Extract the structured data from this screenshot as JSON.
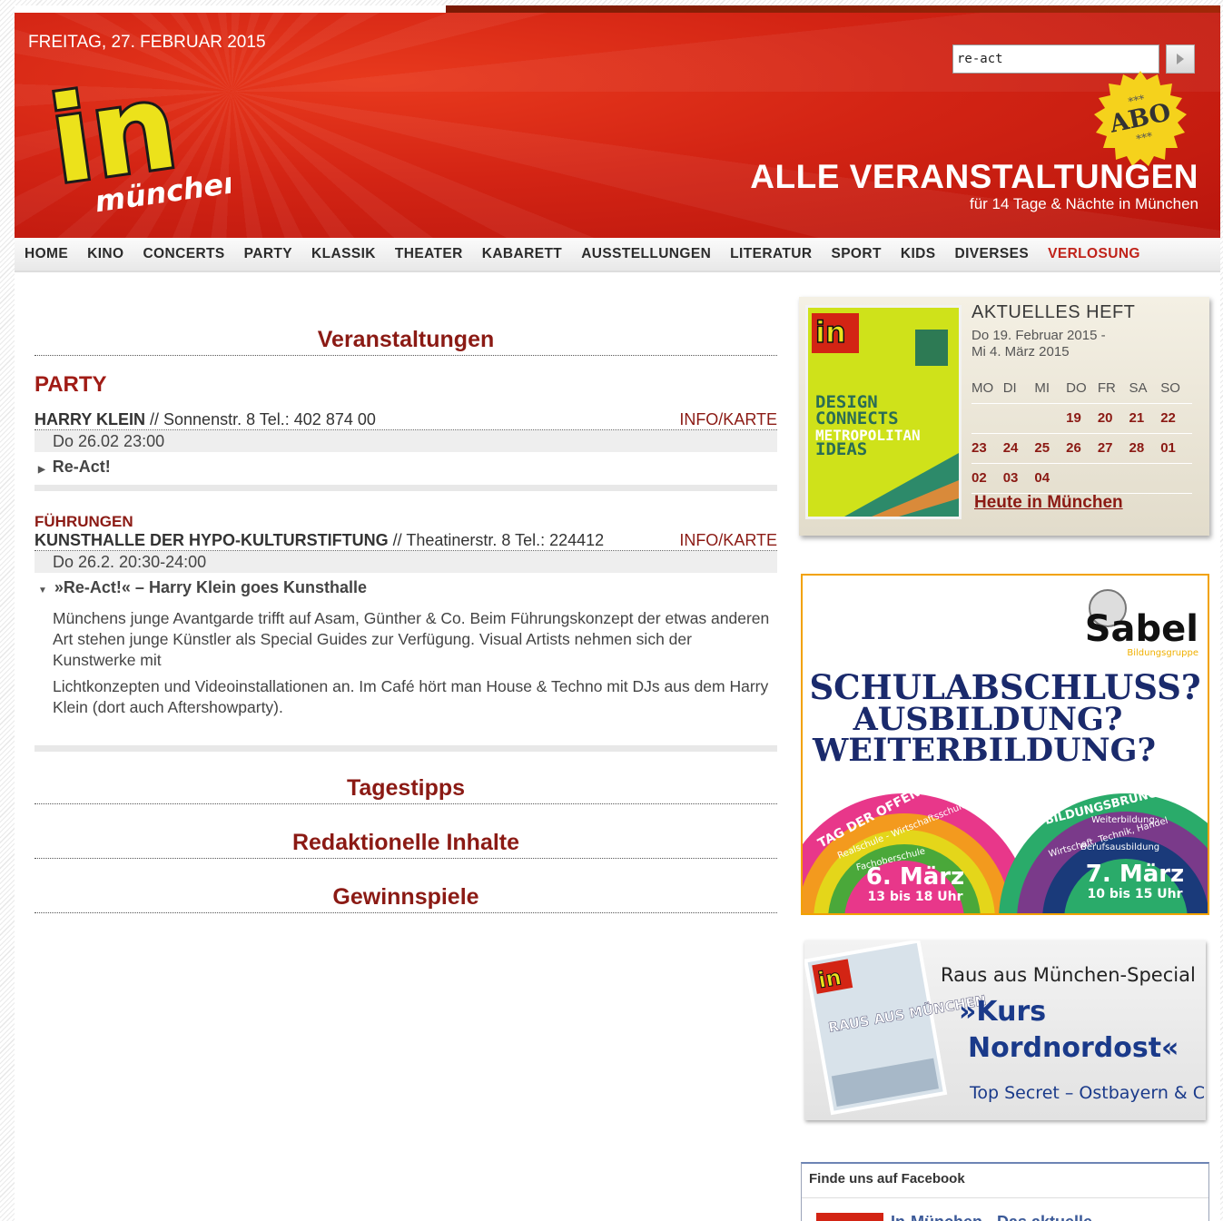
{
  "header": {
    "date": "FREITAG, 27. FEBRUAR 2015",
    "logo_main": "in",
    "logo_sub": "münchen",
    "search_value": "re-act",
    "abo_label": "ABO",
    "abo_stars": "***",
    "headline": "ALLE VERANSTALTUNGEN",
    "subline": "für 14 Tage & Nächte in München"
  },
  "nav": [
    "HOME",
    "KINO",
    "CONCERTS",
    "PARTY",
    "KLASSIK",
    "THEATER",
    "KABARETT",
    "AUSSTELLUNGEN",
    "LITERATUR",
    "SPORT",
    "KIDS",
    "DIVERSES",
    "VERLOSUNG"
  ],
  "main": {
    "section_title": "Veranstaltungen",
    "party_heading": "PARTY",
    "event1": {
      "venue": "HARRY KLEIN",
      "address": " // Sonnenstr. 8 Tel.: 402 874 00",
      "info": "INFO/KARTE",
      "date": "Do 26.02 23:00",
      "title": "Re-Act!"
    },
    "event2": {
      "category": "FÜHRUNGEN",
      "venue": "KUNSTHALLE DER HYPO-KULTURSTIFTUNG",
      "address": " // Theatinerstr. 8 Tel.: 224412",
      "info": "INFO/KARTE",
      "date": "Do 26.2. 20:30-24:00",
      "title": "»Re-Act!« – Harry Klein goes Kunsthalle",
      "desc1": "Münchens junge Avantgarde trifft auf Asam, Günther & Co. Beim Führungskonzept der etwas anderen Art stehen junge Künstler als Special Guides zur Verfügung. Visual Artists nehmen sich der Kunstwerke mit",
      "desc2": "Lichtkonzepten und Videoinstallationen an. Im Café hört man House & Techno mit DJs aus dem Harry Klein (dort auch Aftershowparty)."
    },
    "tagestipps": "Tagestipps",
    "redaktionell": "Redaktionelle Inhalte",
    "gewinnspiele": "Gewinnspiele"
  },
  "heft": {
    "title": "AKTUELLES HEFT",
    "date_line1": "Do 19. Februar 2015 -",
    "date_line2": "Mi 4. März 2015",
    "weekdays": [
      "MO",
      "DI",
      "MI",
      "DO",
      "FR",
      "SA",
      "SO"
    ],
    "weeks": [
      [
        "",
        "",
        "",
        "19",
        "20",
        "21",
        "22"
      ],
      [
        "23",
        "24",
        "25",
        "26",
        "27",
        "28",
        "01"
      ],
      [
        "02",
        "03",
        "04",
        "",
        "",
        "",
        ""
      ]
    ],
    "heute": "Heute in München",
    "cover_texts": [
      "DESIGN",
      "CONNECTS",
      "METROPOLITAN",
      "IDEAS"
    ]
  },
  "ad_sabel": {
    "brand": "Sabel",
    "brand_sub": "Bildungsgruppe",
    "line1": "SCHULABSCHLUSS?",
    "line2": "AUSBILDUNG?",
    "line3": "WEITERBILDUNG?",
    "left_arc": "TAG DER OFFENEN TÜR",
    "left_sub": "Realschule - Wirtschaftsschule",
    "left_sub2": "Fachoberschule",
    "left_date": "6. März",
    "left_time": "13 bis 18 Uhr",
    "right_arc": "BILDUNGSBRUNCH",
    "right_sub": "Weiterbildung:",
    "right_sub2": "Wirtschaft, Technik, Handel",
    "right_sub3": "Berufsausbildung",
    "right_date": "7. März",
    "right_time": "10 bis 15 Uhr"
  },
  "ad_raus": {
    "line1": "Raus aus München-Special",
    "line2": "»Kurs",
    "line3": "Nordnordost«",
    "line4": "Top Secret – Ostbayern & Co.",
    "cover_title": "RAUS AUS MÜNCHEN"
  },
  "facebook": {
    "title": "Finde uns auf Facebook",
    "link": "In-München - Das aktuelle"
  },
  "colors": {
    "brand_red": "#d32414",
    "dark_red": "#8b1a14",
    "yellow": "#e8e21a",
    "ad_blue": "#1a2a6c"
  }
}
